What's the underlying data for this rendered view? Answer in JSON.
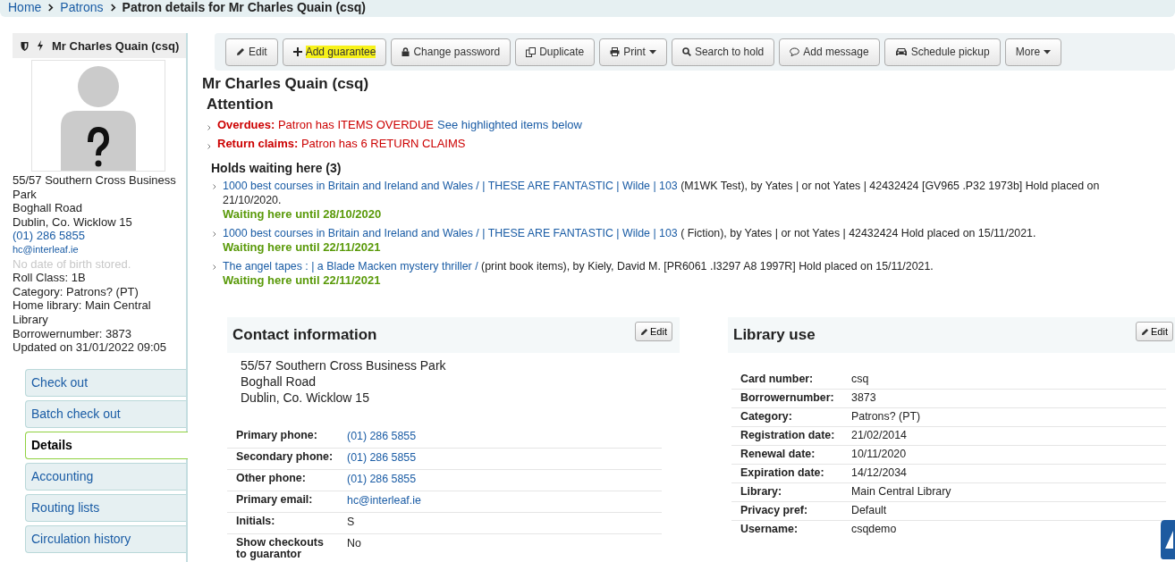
{
  "breadcrumbs": [
    {
      "label": "Home",
      "kind": "link"
    },
    {
      "label": "Patrons",
      "kind": "link"
    },
    {
      "label": "Patron details for Mr Charles Quain (csq)",
      "kind": "current"
    }
  ],
  "patron_card": {
    "name": "Mr Charles Quain (csq)",
    "address": [
      "55/57 Southern Cross Business Park",
      "Boghall Road",
      "Dublin, Co. Wicklow 15"
    ],
    "phone": "(01) 286 5855",
    "email": "hc@interleaf.ie",
    "dob_note": "No date of birth stored.",
    "details": [
      "Roll Class: 1B",
      "Category: Patrons? (PT)",
      "Home library: Main Central Library",
      "Borrowernumber: 3873",
      "Updated on 31/01/2022 09:05"
    ]
  },
  "menu": [
    {
      "label": "Check out",
      "selected": false
    },
    {
      "label": "Batch check out",
      "selected": false
    },
    {
      "label": "Details",
      "selected": true
    },
    {
      "label": "Accounting",
      "selected": false
    },
    {
      "label": "Routing lists",
      "selected": false
    },
    {
      "label": "Circulation history",
      "selected": false
    }
  ],
  "toolbar": [
    {
      "label": "Edit",
      "kind": "pencil",
      "dropdown": false,
      "highlighted": false
    },
    {
      "label": "Add guarantee",
      "kind": "plus",
      "dropdown": false,
      "highlighted": true
    },
    {
      "label": "Change password",
      "kind": "lock",
      "dropdown": false,
      "highlighted": false
    },
    {
      "label": "Duplicate",
      "kind": "copy",
      "dropdown": false,
      "highlighted": false
    },
    {
      "label": "Print",
      "kind": "print",
      "dropdown": true,
      "highlighted": false
    },
    {
      "label": "Search to hold",
      "kind": "search",
      "dropdown": false,
      "highlighted": false
    },
    {
      "label": "Add message",
      "kind": "comment",
      "dropdown": false,
      "highlighted": false
    },
    {
      "label": "Schedule pickup",
      "kind": "car",
      "dropdown": false,
      "highlighted": false
    },
    {
      "label": "More",
      "kind": "plain",
      "dropdown": true,
      "highlighted": false
    }
  ],
  "title": "Mr Charles Quain (csq)",
  "attention": {
    "heading": "Attention",
    "alerts": [
      {
        "label": "Overdues:",
        "text": "Patron has ITEMS OVERDUE",
        "link": "See highlighted items below"
      },
      {
        "label": "Return claims:",
        "text": "Patron has 6 RETURN CLAIMS"
      }
    ]
  },
  "holds": {
    "heading": "Holds waiting here (3)",
    "items": [
      {
        "title": "1000 best courses in Britain and Ireland and Wales / | THESE ARE FANTASTIC | Wilde | 103",
        "rest": "(M1WK Test), by Yates | or not Yates | 42432424 [GV965 .P32 1973b] Hold placed on 21/10/2020.",
        "waiting": "Waiting here until 28/10/2020"
      },
      {
        "title": "1000 best courses in Britain and Ireland and Wales / | THESE ARE FANTASTIC | Wilde | 103",
        "rest": "( Fiction), by Yates | or not Yates | 42432424 Hold placed on 15/11/2021.",
        "waiting": "Waiting here until 22/11/2021"
      },
      {
        "title": "The angel tapes : | a Blade Macken mystery thriller /",
        "rest": "(print book items), by Kiely, David M. [PR6061 .I3297 A8 1997R] Hold placed on 15/11/2021.",
        "waiting": "Waiting here until 22/11/2021"
      }
    ]
  },
  "contact": {
    "heading": "Contact information",
    "edit": "Edit",
    "address": [
      "55/57 Southern Cross Business Park",
      "Boghall Road",
      "Dublin, Co. Wicklow 15"
    ],
    "rows": [
      {
        "label": "Primary phone:",
        "value": "(01) 286 5855",
        "kind": "link"
      },
      {
        "label": "Secondary phone:",
        "value": "(01) 286 5855",
        "kind": "link"
      },
      {
        "label": "Other phone:",
        "value": "(01) 286 5855",
        "kind": "link"
      },
      {
        "label": "Primary email:",
        "value": "hc@interleaf.ie",
        "kind": "link"
      },
      {
        "label": "Initials:",
        "value": "S",
        "kind": "text"
      },
      {
        "label": "Show checkouts to guarantor",
        "value": "No",
        "kind": "text"
      }
    ]
  },
  "library_use": {
    "heading": "Library use",
    "edit": "Edit",
    "rows": [
      {
        "label": "Card number:",
        "value": "csq"
      },
      {
        "label": "Borrowernumber:",
        "value": "3873"
      },
      {
        "label": "Category:",
        "value": "Patrons? (PT)"
      },
      {
        "label": "Registration date:",
        "value": "21/02/2014"
      },
      {
        "label": "Renewal date:",
        "value": "10/11/2020"
      },
      {
        "label": "Expiration date:",
        "value": "14/12/2034"
      },
      {
        "label": "Library:",
        "value": "Main Central Library"
      },
      {
        "label": "Privacy pref:",
        "value": "Default"
      },
      {
        "label": "Username:",
        "value": "csqdemo"
      }
    ]
  }
}
